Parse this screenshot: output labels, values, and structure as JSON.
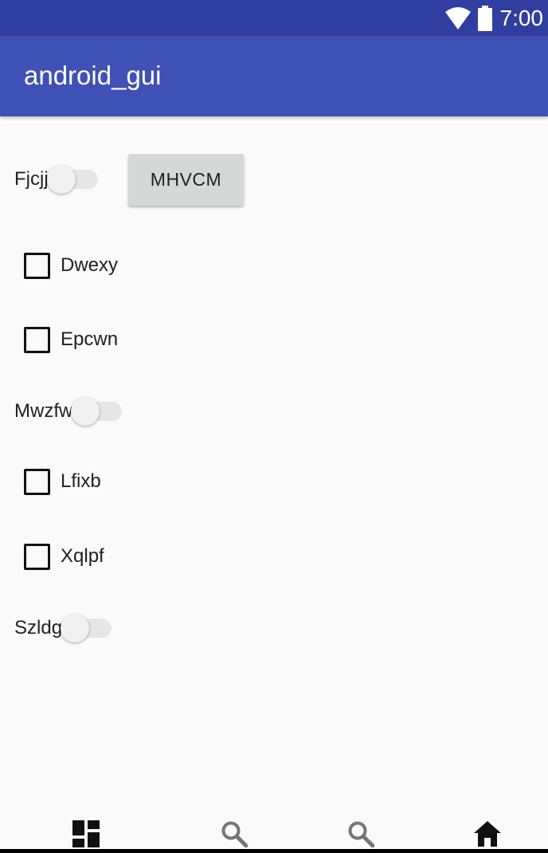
{
  "status_bar": {
    "time": "7:00",
    "wifi_icon": "wifi-icon",
    "battery_icon": "battery-icon"
  },
  "app_bar": {
    "title": "android_gui"
  },
  "content": {
    "switch_1": {
      "label": "Fjcjj",
      "checked": false
    },
    "button": {
      "label": "MHVCM"
    },
    "checkbox_1": {
      "label": "Dwexy",
      "checked": false
    },
    "checkbox_2": {
      "label": "Epcwn",
      "checked": false
    },
    "switch_2": {
      "label": "Mwzfw",
      "checked": false
    },
    "checkbox_3": {
      "label": "Lfixb",
      "checked": false
    },
    "checkbox_4": {
      "label": "Xqlpf",
      "checked": false
    },
    "switch_3": {
      "label": "Szldg",
      "checked": false
    }
  },
  "bottom_nav": {
    "items": [
      {
        "icon": "dashboard-icon"
      },
      {
        "icon": "search-icon"
      },
      {
        "icon": "search-icon"
      },
      {
        "icon": "home-icon"
      }
    ]
  },
  "colors": {
    "status_bar": "#303f9f",
    "app_bar": "#3f51b5",
    "background": "#fafafa",
    "button": "#d6d7d7"
  }
}
